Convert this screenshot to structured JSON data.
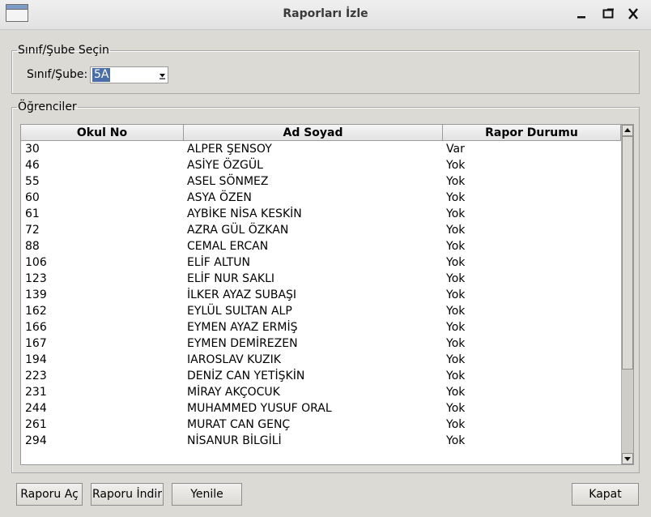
{
  "window": {
    "title": "Raporları İzle"
  },
  "class_group": {
    "legend": "Sınıf/Şube Seçin",
    "label": "Sınıf/Şube:",
    "selected": "5A"
  },
  "students_group": {
    "legend": "Öğrenciler"
  },
  "table": {
    "columns": [
      "Okul No",
      "Ad Soyad",
      "Rapor Durumu"
    ],
    "rows": [
      {
        "no": "30",
        "name": "ALPER ŞENSOY",
        "status": "Var"
      },
      {
        "no": "46",
        "name": "ASİYE ÖZGÜL",
        "status": "Yok"
      },
      {
        "no": "55",
        "name": "ASEL SÖNMEZ",
        "status": "Yok"
      },
      {
        "no": "60",
        "name": "ASYA ÖZEN",
        "status": "Yok"
      },
      {
        "no": "61",
        "name": "AYBİKE NİSA KESKİN",
        "status": "Yok"
      },
      {
        "no": "72",
        "name": "AZRA GÜL ÖZKAN",
        "status": "Yok"
      },
      {
        "no": "88",
        "name": "CEMAL ERCAN",
        "status": "Yok"
      },
      {
        "no": "106",
        "name": "ELİF ALTUN",
        "status": "Yok"
      },
      {
        "no": "123",
        "name": "ELİF NUR SAKLI",
        "status": "Yok"
      },
      {
        "no": "139",
        "name": "İLKER AYAZ SUBAŞI",
        "status": "Yok"
      },
      {
        "no": "162",
        "name": "EYLÜL SULTAN ALP",
        "status": "Yok"
      },
      {
        "no": "166",
        "name": "EYMEN AYAZ ERMİŞ",
        "status": "Yok"
      },
      {
        "no": "167",
        "name": "EYMEN DEMİREZEN",
        "status": "Yok"
      },
      {
        "no": "194",
        "name": "IAROSLAV KUZIK",
        "status": "Yok"
      },
      {
        "no": "223",
        "name": "DENİZ CAN YETİŞKİN",
        "status": "Yok"
      },
      {
        "no": "231",
        "name": "MİRAY AKÇOCUK",
        "status": "Yok"
      },
      {
        "no": "244",
        "name": "MUHAMMED YUSUF ORAL",
        "status": "Yok"
      },
      {
        "no": "261",
        "name": "MURAT CAN GENÇ",
        "status": "Yok"
      },
      {
        "no": "294",
        "name": "NİSANUR BİLGİLİ",
        "status": "Yok"
      }
    ]
  },
  "buttons": {
    "open": "Raporu Aç",
    "download": "Raporu İndir",
    "refresh": "Yenile",
    "close": "Kapat"
  },
  "colors": {
    "window_bg": "#dcdad5",
    "selection": "#4a6ea9"
  },
  "icons": {
    "app": "window-icon",
    "minimize": "minimize-icon",
    "maximize": "maximize-icon",
    "close": "close-icon",
    "dropdown": "chevron-down-icon",
    "scroll_up": "arrow-up-icon",
    "scroll_down": "arrow-down-icon"
  }
}
